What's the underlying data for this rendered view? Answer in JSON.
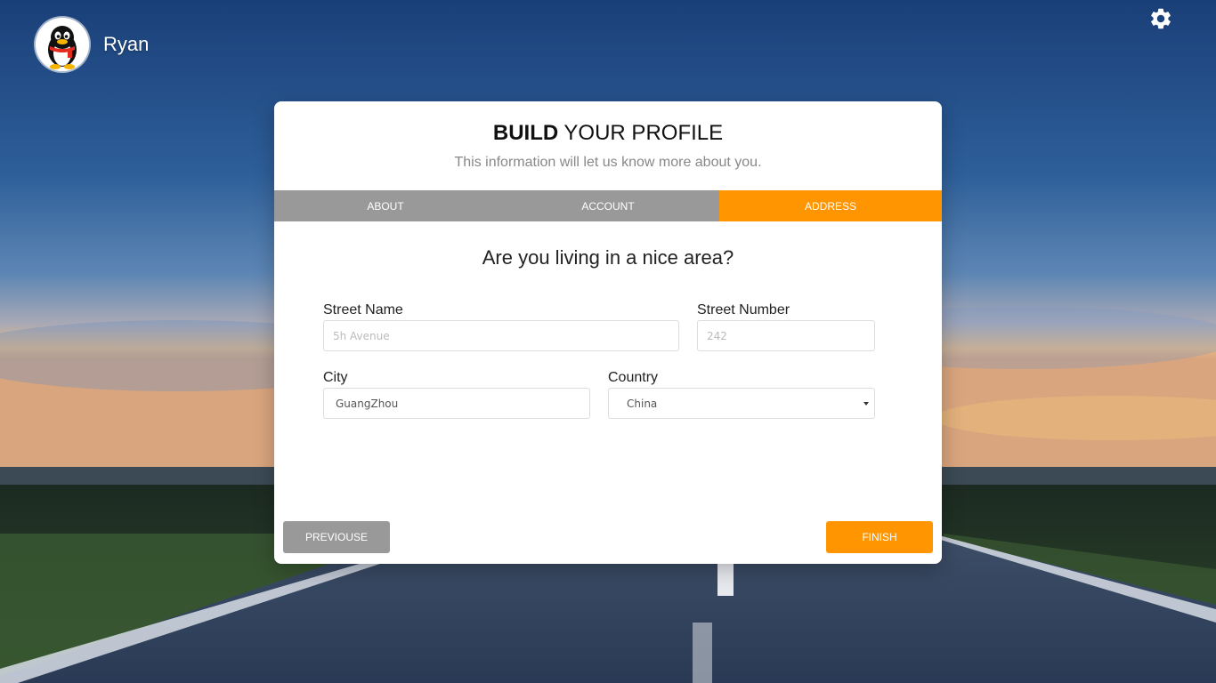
{
  "user": {
    "name": "Ryan",
    "avatar_icon": "penguin-avatar-icon"
  },
  "settings_icon": "gear-icon",
  "card": {
    "title_bold": "BUILD",
    "title_rest": " YOUR PROFILE",
    "subtitle": "This information will let us know more about you."
  },
  "tabs": [
    {
      "label": "ABOUT",
      "active": false
    },
    {
      "label": "ACCOUNT",
      "active": false
    },
    {
      "label": "ADDRESS",
      "active": true
    }
  ],
  "question": "Are you living in a nice area?",
  "form": {
    "street_name": {
      "label": "Street Name",
      "value": "",
      "placeholder": "5h Avenue"
    },
    "street_number": {
      "label": "Street Number",
      "value": "",
      "placeholder": "242"
    },
    "city": {
      "label": "City",
      "value": "GuangZhou",
      "placeholder": ""
    },
    "country": {
      "label": "Country",
      "selected": "China"
    }
  },
  "buttons": {
    "previous": "PREVIOUSE",
    "finish": "FINISH"
  },
  "colors": {
    "accent": "#ff9500",
    "tab_inactive": "#999999",
    "button_secondary": "#999999"
  }
}
